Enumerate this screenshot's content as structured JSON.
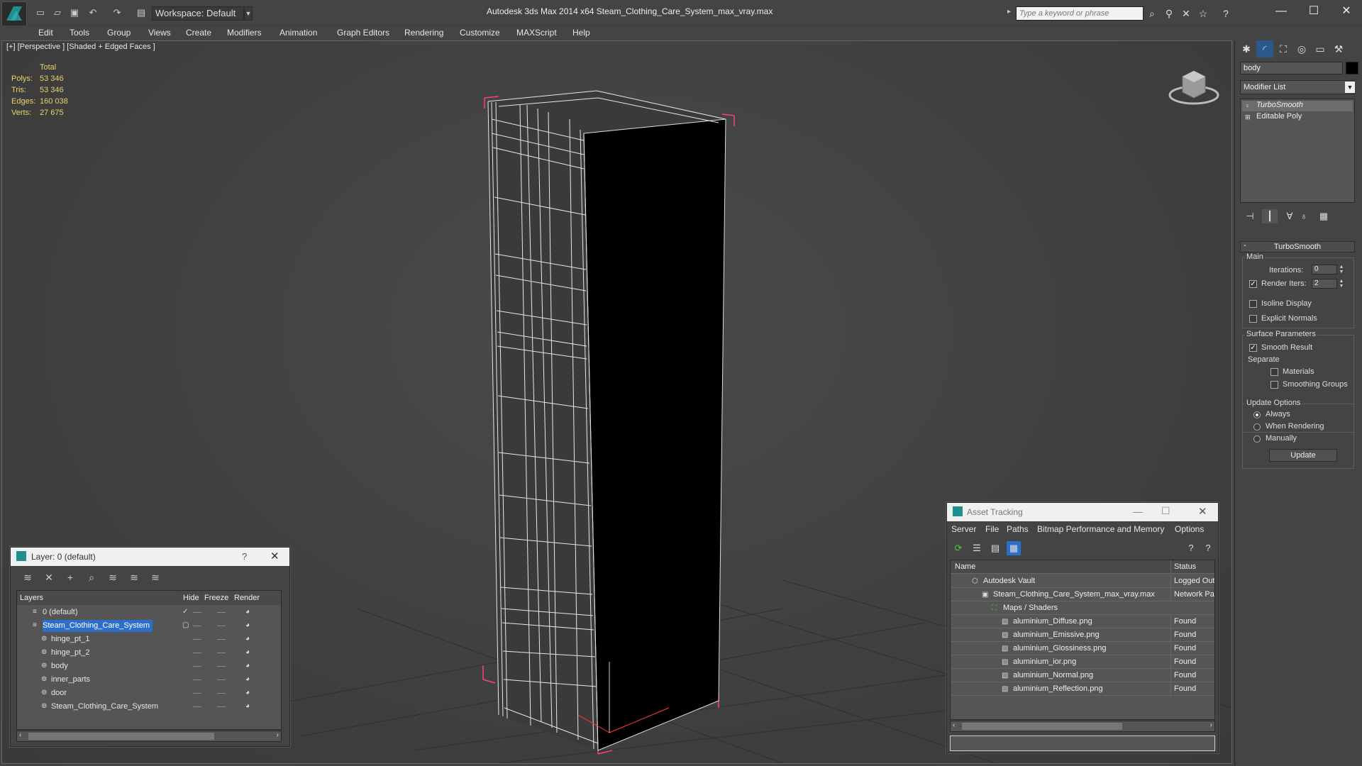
{
  "titlebar": {
    "workspace": "Workspace: Default",
    "title": "Autodesk 3ds Max  2014 x64      Steam_Clothing_Care_System_max_vray.max",
    "search_placeholder": "Type a keyword or phrase"
  },
  "menu": [
    "Edit",
    "Tools",
    "Group",
    "Views",
    "Create",
    "Modifiers",
    "Animation",
    "Graph Editors",
    "Rendering",
    "Customize",
    "MAXScript",
    "Help"
  ],
  "viewport": {
    "label": "[+] [Perspective ] [Shaded + Edged Faces ]",
    "stats": {
      "header": "Total",
      "rows": [
        {
          "label": "Polys:",
          "value": "53 346"
        },
        {
          "label": "Tris:",
          "value": "53 346"
        },
        {
          "label": "Edges:",
          "value": "160 038"
        },
        {
          "label": "Verts:",
          "value": "27 675"
        }
      ]
    }
  },
  "command_panel": {
    "object_name": "body",
    "modifier_list": "Modifier List",
    "stack": [
      "TurboSmooth",
      "Editable Poly"
    ],
    "rollout_title": "TurboSmooth",
    "main_group": "Main",
    "iterations_label": "Iterations:",
    "iterations_value": "0",
    "render_iters_label": "Render Iters:",
    "render_iters_value": "2",
    "isoline_label": "Isoline Display",
    "explicit_normals_label": "Explicit Normals",
    "surface_group": "Surface Parameters",
    "smooth_result_label": "Smooth Result",
    "separate_label": "Separate",
    "materials_label": "Materials",
    "smoothing_groups_label": "Smoothing Groups",
    "update_group": "Update Options",
    "always_label": "Always",
    "when_rendering_label": "When Rendering",
    "manually_label": "Manually",
    "update_button": "Update"
  },
  "layer_dialog": {
    "title": "Layer: 0 (default)",
    "help": "?",
    "columns": [
      "Layers",
      "Hide",
      "Freeze",
      "Render"
    ],
    "rows": [
      {
        "name": "0 (default)",
        "level": 0,
        "selected": false,
        "checked": true
      },
      {
        "name": "Steam_Clothing_Care_System",
        "level": 0,
        "selected": true,
        "checked": false
      },
      {
        "name": "hinge_pt_1",
        "level": 1,
        "selected": false,
        "checked": false
      },
      {
        "name": "hinge_pt_2",
        "level": 1,
        "selected": false,
        "checked": false
      },
      {
        "name": "body",
        "level": 1,
        "selected": false,
        "checked": false
      },
      {
        "name": "inner_parts",
        "level": 1,
        "selected": false,
        "checked": false
      },
      {
        "name": "door",
        "level": 1,
        "selected": false,
        "checked": false
      },
      {
        "name": "Steam_Clothing_Care_System",
        "level": 1,
        "selected": false,
        "checked": false
      }
    ]
  },
  "asset_dialog": {
    "title": "Asset Tracking",
    "menu": [
      "Server",
      "File",
      "Paths",
      "Bitmap Performance and Memory",
      "Options"
    ],
    "columns": [
      "Name",
      "Status"
    ],
    "rows": [
      {
        "name": "Autodesk Vault",
        "status": "Logged Out",
        "level": 1
      },
      {
        "name": "Steam_Clothing_Care_System_max_vray.max",
        "status": "Network Path",
        "level": 2
      },
      {
        "name": "Maps / Shaders",
        "status": "",
        "level": 3
      },
      {
        "name": "aluminium_Diffuse.png",
        "status": "Found",
        "level": 4
      },
      {
        "name": "aluminium_Emissive.png",
        "status": "Found",
        "level": 4
      },
      {
        "name": "aluminium_Glossiness.png",
        "status": "Found",
        "level": 4
      },
      {
        "name": "aluminium_ior.png",
        "status": "Found",
        "level": 4
      },
      {
        "name": "aluminium_Normal.png",
        "status": "Found",
        "level": 4
      },
      {
        "name": "aluminium_Reflection.png",
        "status": "Found",
        "level": 4
      }
    ]
  },
  "colors": {
    "selection": "#2d6fc8",
    "stats_text": "#e8d56a",
    "wire": "#ffffff",
    "bbox": "#ff3b8a"
  }
}
